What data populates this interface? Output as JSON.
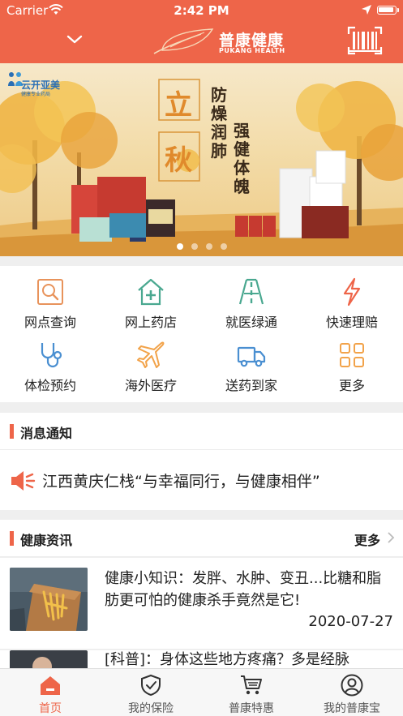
{
  "status_bar": {
    "carrier": "Carrier",
    "time": "2:42 PM"
  },
  "header": {
    "brand_cn": "普康健康",
    "brand_en": "PuKang Health",
    "bg_color": "#ee6549"
  },
  "banner": {
    "logo_text": "云开亚美",
    "logo_sub": "健康专业药局",
    "theme_glyph": "立秋",
    "slogan_1": "防燥润肺",
    "slogan_2": "强健体魄",
    "slide_count": 4,
    "active_slide": 1
  },
  "quick_actions": [
    {
      "label": "网点查询",
      "icon": "search-icon",
      "color": "#e8935b"
    },
    {
      "label": "网上药店",
      "icon": "pharmacy-icon",
      "color": "#4aa890"
    },
    {
      "label": "就医绿通",
      "icon": "road-icon",
      "color": "#4aa890"
    },
    {
      "label": "快速理赔",
      "icon": "lightning-icon",
      "color": "#ee6549"
    },
    {
      "label": "体检预约",
      "icon": "stethoscope-icon",
      "color": "#4a8fd1"
    },
    {
      "label": "海外医疗",
      "icon": "airplane-icon",
      "color": "#f2a34a"
    },
    {
      "label": "送药到家",
      "icon": "truck-icon",
      "color": "#4a8fd1"
    },
    {
      "label": "更多",
      "icon": "grid-more-icon",
      "color": "#f2a34a"
    }
  ],
  "notice": {
    "title": "消息通知",
    "text": "江西黄庆仁栈“与幸福同行，与健康相伴”"
  },
  "health_news": {
    "title": "健康资讯",
    "more_label": "更多",
    "items": [
      {
        "headline": "健康小知识：发胖、水肿、变丑...比糖和脂肪更可怕的健康杀手竟然是它!",
        "date": "2020-07-27"
      },
      {
        "headline": "[科普]：身体这些地方疼痛？多是经脉",
        "date": ""
      }
    ]
  },
  "tab_bar": {
    "tabs": [
      {
        "label": "首页",
        "icon": "home-icon",
        "active": true
      },
      {
        "label": "我的保险",
        "icon": "shield-check-icon",
        "active": false
      },
      {
        "label": "普康特惠",
        "icon": "cart-icon",
        "active": false
      },
      {
        "label": "我的普康宝",
        "icon": "user-icon",
        "active": false
      }
    ],
    "active_color": "#ee6549"
  }
}
